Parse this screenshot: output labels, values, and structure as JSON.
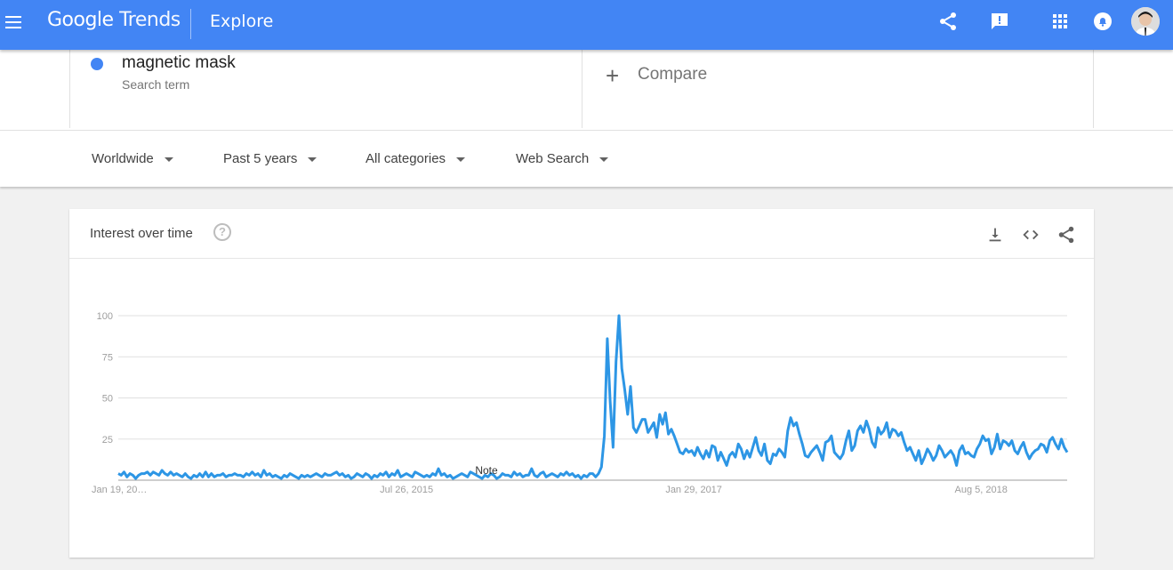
{
  "header": {
    "logo_google": "Google",
    "logo_trends": "Trends",
    "page_title": "Explore",
    "icons": [
      "menu-icon",
      "share-icon",
      "feedback-icon",
      "apps-icon",
      "notifications-icon",
      "account-avatar"
    ]
  },
  "search_terms": [
    {
      "name": "magnetic mask",
      "type": "Search term",
      "color": "#4285f4"
    }
  ],
  "compare": {
    "label": "Compare"
  },
  "filters": {
    "region": "Worldwide",
    "time": "Past 5 years",
    "category": "All categories",
    "property": "Web Search"
  },
  "card": {
    "title": "Interest over time",
    "icons": [
      "help-icon",
      "download-icon",
      "embed-icon",
      "share-icon"
    ]
  },
  "chart_data": {
    "type": "line",
    "series": [
      {
        "name": "magnetic mask",
        "color": "#2d96e5",
        "values": [
          4,
          3,
          5,
          2,
          4,
          3,
          1,
          3,
          4,
          4,
          5,
          3,
          5,
          4,
          3,
          6,
          4,
          3,
          5,
          3,
          4,
          3,
          2,
          4,
          2,
          1,
          3,
          2,
          4,
          2,
          5,
          2,
          4,
          2,
          3,
          3,
          4,
          2,
          3,
          3,
          4,
          3,
          3,
          2,
          4,
          3,
          5,
          3,
          4,
          2,
          6,
          3,
          4,
          2,
          3,
          2,
          1,
          3,
          2,
          4,
          3,
          2,
          1,
          3,
          2,
          3,
          2,
          3,
          4,
          3,
          2,
          4,
          3,
          3,
          4,
          5,
          3,
          4,
          2,
          3,
          1,
          2,
          4,
          3,
          2,
          4,
          3,
          1,
          3,
          2,
          4,
          3,
          5,
          2,
          4,
          3,
          6,
          2,
          3,
          4,
          3,
          2,
          5,
          4,
          3,
          2,
          3,
          2,
          4,
          3,
          7,
          3,
          4,
          2,
          3,
          1,
          2,
          3,
          4,
          3,
          2,
          5,
          4,
          3,
          2,
          1,
          3,
          2,
          4,
          3,
          1,
          2,
          4,
          3,
          3,
          2,
          5,
          3,
          4,
          2,
          3,
          3,
          7,
          3,
          2,
          4,
          5,
          2,
          3,
          4,
          3,
          2,
          4,
          3,
          5,
          3,
          4,
          2,
          3,
          1,
          3,
          2,
          4,
          4,
          2,
          4,
          8,
          27,
          86,
          48,
          20,
          72,
          100,
          68,
          55,
          40,
          57,
          32,
          29,
          33,
          37,
          37,
          29,
          32,
          35,
          26,
          40,
          34,
          41,
          28,
          31,
          27,
          22,
          17,
          16,
          19,
          17,
          18,
          15,
          20,
          16,
          13,
          18,
          14,
          21,
          20,
          12,
          17,
          13,
          9,
          15,
          17,
          14,
          22,
          19,
          13,
          18,
          14,
          20,
          26,
          18,
          15,
          22,
          12,
          10,
          16,
          15,
          19,
          17,
          14,
          30,
          38,
          33,
          35,
          28,
          22,
          15,
          14,
          17,
          19,
          21,
          17,
          12,
          23,
          24,
          27,
          17,
          15,
          13,
          16,
          24,
          30,
          18,
          21,
          30,
          33,
          29,
          36,
          31,
          23,
          20,
          32,
          28,
          30,
          35,
          26,
          31,
          30,
          27,
          29,
          23,
          18,
          20,
          16,
          12,
          18,
          10,
          14,
          19,
          16,
          12,
          15,
          21,
          18,
          14,
          16,
          18,
          15,
          9,
          18,
          21,
          16,
          17,
          15,
          14,
          19,
          22,
          27,
          24,
          25,
          16,
          20,
          28,
          19,
          24,
          23,
          21,
          24,
          18,
          16,
          20,
          23,
          17,
          13,
          16,
          18,
          19,
          22,
          21,
          17,
          24,
          26,
          22,
          19,
          25,
          20,
          17
        ],
        "annotation": {
          "label": "Note"
        }
      }
    ],
    "x_tick_labels": [
      "Jan 19, 20…",
      "Jul 26, 2015",
      "Jan 29, 2017",
      "Aug 5, 2018"
    ],
    "y_ticks": [
      25,
      50,
      75,
      100
    ],
    "ylim": [
      0,
      100
    ],
    "grid": true,
    "xlabel": "",
    "ylabel": ""
  }
}
